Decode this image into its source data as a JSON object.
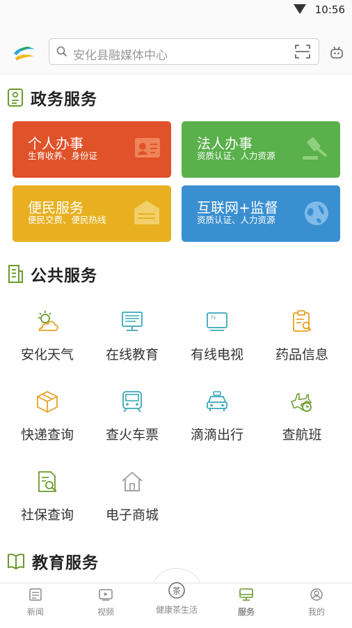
{
  "status": {
    "time": "10:56"
  },
  "search": {
    "placeholder": "安化县融媒体中心"
  },
  "gov": {
    "title": "政务服务",
    "cards": [
      {
        "title": "个人办事",
        "sub": "生育收养、身份证",
        "color": "#e0522a"
      },
      {
        "title": "法人办事",
        "sub": "资质认证、人力资源",
        "color": "#5ab04b"
      },
      {
        "title": "便民服务",
        "sub": "便民交费、便民热线",
        "color": "#e8b020"
      },
      {
        "title": "互联网+监督",
        "sub": "资质认证、人力资源",
        "color": "#3a8fd0"
      }
    ]
  },
  "public": {
    "title": "公共服务",
    "items": [
      {
        "label": "安化天气",
        "icon": "weather-icon"
      },
      {
        "label": "在线教育",
        "icon": "monitor-icon"
      },
      {
        "label": "有线电视",
        "icon": "tv-icon"
      },
      {
        "label": "药品信息",
        "icon": "clipboard-search-icon"
      },
      {
        "label": "快递查询",
        "icon": "package-icon"
      },
      {
        "label": "查火车票",
        "icon": "train-icon"
      },
      {
        "label": "滴滴出行",
        "icon": "taxi-icon"
      },
      {
        "label": "查航班",
        "icon": "plane-clock-icon"
      },
      {
        "label": "社保查询",
        "icon": "document-search-icon"
      },
      {
        "label": "电子商城",
        "icon": "home-icon"
      }
    ]
  },
  "edu": {
    "title": "教育服务"
  },
  "tabs": {
    "news": "新闻",
    "video": "视频",
    "center": "健康茶生活",
    "service": "服务",
    "mine": "我的"
  },
  "colors": {
    "accent": "#6a9a2a",
    "orange": "#e8a020",
    "teal": "#3aa8b8"
  }
}
